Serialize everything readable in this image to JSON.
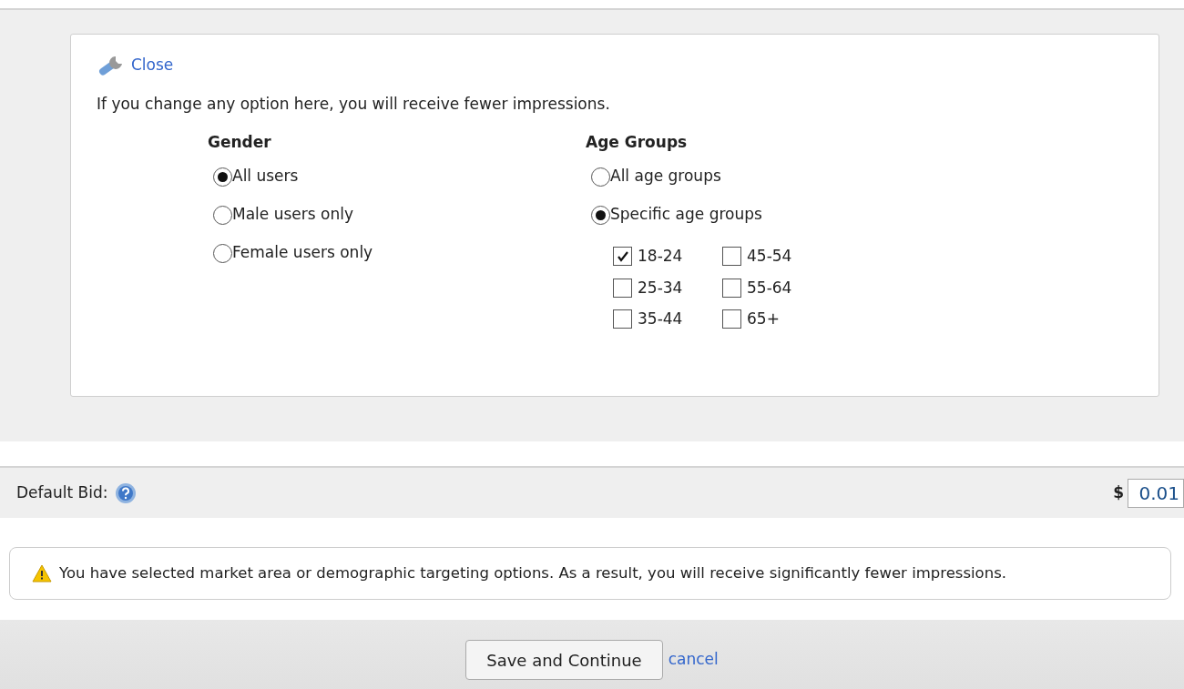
{
  "panel": {
    "close_link": "Close",
    "notice": "If you change any option here, you will receive fewer impressions.",
    "gender": {
      "heading": "Gender",
      "options": [
        {
          "label": "All users",
          "selected": true
        },
        {
          "label": "Male users only",
          "selected": false
        },
        {
          "label": "Female users only",
          "selected": false
        }
      ]
    },
    "age_groups": {
      "heading": "Age Groups",
      "options": [
        {
          "label": "All age groups",
          "selected": false
        },
        {
          "label": "Specific age groups",
          "selected": true
        }
      ],
      "groups": [
        {
          "label": "18-24",
          "checked": true
        },
        {
          "label": "45-54",
          "checked": false
        },
        {
          "label": "25-34",
          "checked": false
        },
        {
          "label": "55-64",
          "checked": false
        },
        {
          "label": "35-44",
          "checked": false
        },
        {
          "label": "65+",
          "checked": false
        }
      ]
    }
  },
  "default_bid": {
    "label": "Default Bid:",
    "currency": "$",
    "value": "0.01"
  },
  "warning": "You have selected market area or demographic targeting options. As a result, you will receive significantly fewer impressions.",
  "footer": {
    "save_button": "Save and Continue",
    "cancel_link": "cancel"
  }
}
